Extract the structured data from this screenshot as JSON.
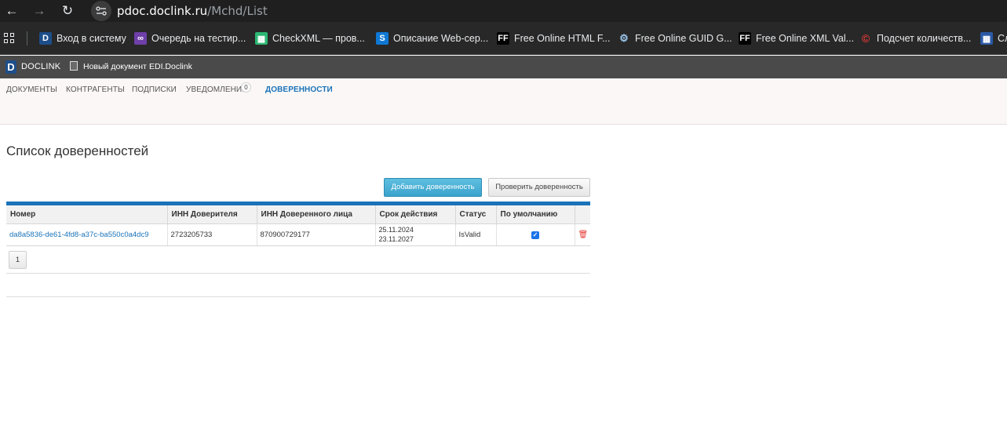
{
  "browser": {
    "url_host": "pdoc.doclink.ru",
    "url_path": "/Mchd/List",
    "bookmarks": [
      {
        "label": "Вход в систему",
        "icon": "doclink-icon"
      },
      {
        "label": "Очередь на тестир...",
        "icon": "visual-studio-icon"
      },
      {
        "label": "CheckXML — пров...",
        "icon": "checkxml-icon"
      },
      {
        "label": "Описание Web-сер...",
        "icon": "sharepoint-icon"
      },
      {
        "label": "Free Online HTML F...",
        "icon": "ff-icon"
      },
      {
        "label": "Free Online GUID G...",
        "icon": "gears-icon"
      },
      {
        "label": "Free Online XML Val...",
        "icon": "ff-icon"
      },
      {
        "label": "Подсчет количеств...",
        "icon": "copyright-icon"
      },
      {
        "label": "Сл",
        "icon": "doc-icon"
      }
    ]
  },
  "app_bar": {
    "logo_letter": "D",
    "logo_text": "DOCLINK",
    "new_document": "Новый документ",
    "edi_link": "EDI.Doclink"
  },
  "nav": {
    "items": [
      "ДОКУМЕНТЫ",
      "КОНТРАГЕНТЫ",
      "ПОДПИСКИ",
      "УВЕДОМЛЕНИЯ",
      "ДОВЕРЕННОСТИ"
    ],
    "notifications_count": "0",
    "active": "ДОВЕРЕННОСТИ"
  },
  "page": {
    "title": "Список доверенностей",
    "add_button": "Добавить доверенность",
    "check_button": "Проверить доверенность"
  },
  "table": {
    "headers": [
      "Номер",
      "ИНН Доверителя",
      "ИНН Доверенного лица",
      "Срок действия",
      "Статус",
      "По умолчанию",
      ""
    ],
    "rows": [
      {
        "number": "da8a5836-de61-4fd8-a37c-ba550c0a4dc9",
        "inn_principal": "2723205733",
        "inn_trustee": "870900729177",
        "date_from": "25.11.2024",
        "date_to": "23.11.2027",
        "status": "IsValid",
        "is_default": true
      }
    ]
  },
  "pager": {
    "current": "1"
  },
  "colors": {
    "accent": "#1a73b9",
    "add_button": "#3aa3cc",
    "delete": "#e53935"
  }
}
